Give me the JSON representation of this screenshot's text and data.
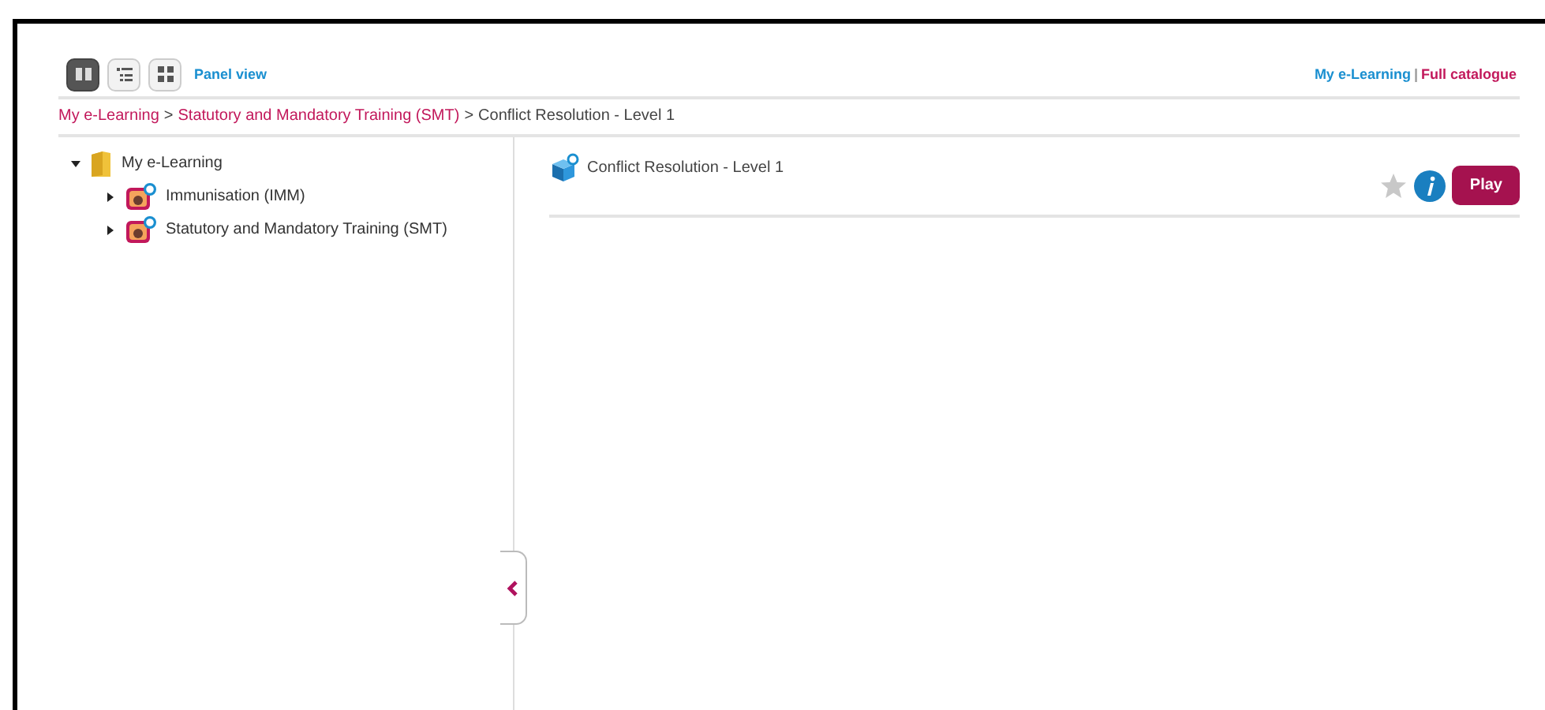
{
  "toolbar": {
    "view_buttons": [
      {
        "kind": "panel",
        "selected": true
      },
      {
        "kind": "list",
        "selected": false
      },
      {
        "kind": "grid",
        "selected": false
      }
    ],
    "view_label": "Panel view",
    "links": [
      {
        "label": "My e-Learning",
        "kind": "primary"
      },
      {
        "label": "|",
        "kind": "separator"
      },
      {
        "label": "Full catalogue",
        "kind": "accent"
      }
    ]
  },
  "breadcrumb": [
    {
      "label": "My e-Learning",
      "kind": "link"
    },
    {
      "label": ">",
      "kind": "separator"
    },
    {
      "label": "Statutory and Mandatory Training (SMT)",
      "kind": "link"
    },
    {
      "label": ">",
      "kind": "separator"
    },
    {
      "label": "Conflict Resolution - Level 1",
      "kind": "current"
    }
  ],
  "tree": [
    {
      "label": "My e-Learning",
      "kind": "folder",
      "expanded": true,
      "children": [
        {
          "label": "Immunisation (IMM)",
          "kind": "course",
          "expanded": false
        },
        {
          "label": "Statutory and Mandatory Training (SMT)",
          "kind": "course",
          "expanded": false
        }
      ]
    }
  ],
  "course": {
    "title": "Conflict Resolution - Level 1",
    "favourite": false,
    "play_button": "Play"
  }
}
